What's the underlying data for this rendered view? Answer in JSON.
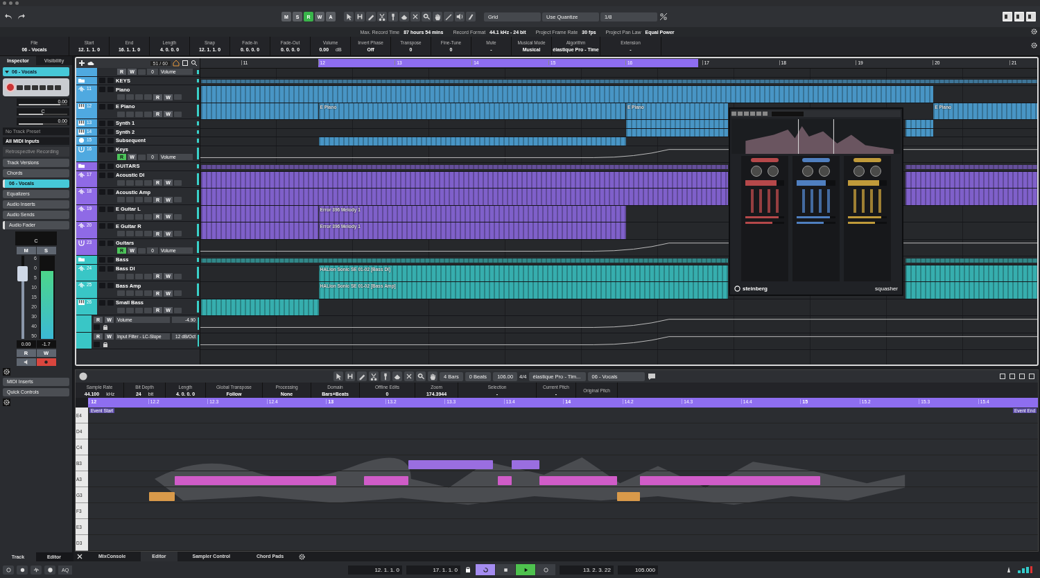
{
  "toolbar": {
    "mode_buttons": [
      {
        "label": "M",
        "on": false
      },
      {
        "label": "S",
        "on": false
      },
      {
        "label": "R",
        "on": true
      },
      {
        "label": "W",
        "on": false
      },
      {
        "label": "A",
        "on": false
      }
    ],
    "snap_type": "Grid",
    "quantize_mode": "Use Quantize",
    "quantize_value": "1/8"
  },
  "status": [
    {
      "label": "Max. Record Time",
      "value": "87 hours 54 mins"
    },
    {
      "label": "Record Format",
      "value": "44.1 kHz - 24 bit"
    },
    {
      "label": "Project Frame Rate",
      "value": "30 fps"
    },
    {
      "label": "Project Pan Law",
      "value": "Equal Power"
    }
  ],
  "infoline": [
    {
      "label": "File",
      "value": "06 - Vocals"
    },
    {
      "label": "Start",
      "value": "12. 1. 1. 0"
    },
    {
      "label": "End",
      "value": "16. 1. 1. 0"
    },
    {
      "label": "Length",
      "value": "4. 0. 0. 0"
    },
    {
      "label": "Snap",
      "value": "12. 1. 1. 0"
    },
    {
      "label": "Fade-In",
      "value": "0. 0. 0. 0"
    },
    {
      "label": "Fade-Out",
      "value": "0. 0. 0. 0"
    },
    {
      "label": "Volume",
      "value": "0.00",
      "unit": "dB"
    },
    {
      "label": "Invert Phase",
      "value": "Off"
    },
    {
      "label": "Transpose",
      "value": "0"
    },
    {
      "label": "Fine-Tune",
      "value": "0"
    },
    {
      "label": "Mute",
      "value": "-"
    },
    {
      "label": "Musical Mode",
      "value": "Musical"
    },
    {
      "label": "Algorithm",
      "value": "élastique Pro - Time"
    },
    {
      "label": "Extension",
      "value": "-"
    }
  ],
  "inspector": {
    "tabs": [
      {
        "label": "Inspector",
        "selected": true
      },
      {
        "label": "Visibility",
        "selected": false
      }
    ],
    "track_name": "06 - Vocals",
    "sliders": [
      {
        "kind": "volume",
        "value": "0.00",
        "level": 0.86
      },
      {
        "kind": "pan",
        "value": "C",
        "level": 0.5
      },
      {
        "kind": "delay",
        "value": "0.00",
        "level": 0.5
      }
    ],
    "preset": "No Track Preset",
    "input": "All MIDI Inputs",
    "retro": "Retrospective Recording",
    "sections": [
      {
        "label": "Track Versions",
        "kind": "section",
        "expanded": false
      },
      {
        "label": "Chords",
        "kind": "section",
        "expanded": false
      },
      {
        "label": "06 - Vocals",
        "kind": "track",
        "expanded": true
      },
      {
        "label": "Equalizers",
        "kind": "section",
        "expanded": false
      },
      {
        "label": "Audio Inserts",
        "kind": "section",
        "expanded": false
      },
      {
        "label": "Audio Sends",
        "kind": "section",
        "expanded": false
      },
      {
        "label": "Audio Fader",
        "kind": "section",
        "expanded": true
      }
    ],
    "fader": {
      "pan": "C",
      "top_buttons": [
        "M",
        "S"
      ],
      "scale": [
        "6",
        "0",
        "5",
        "10",
        "15",
        "20",
        "30",
        "40",
        "50"
      ],
      "level": 0.78,
      "meter": {
        "level": 0.82
      },
      "value": "0.00",
      "peak": "-1.7",
      "bottom_buttons": [
        "R",
        "W"
      ],
      "record": true
    },
    "more_sections": [
      {
        "label": "MIDI Inserts",
        "expanded": false
      },
      {
        "label": "Quick Controls",
        "expanded": false
      }
    ],
    "bottom_tabs": [
      {
        "label": "Track",
        "selected": false
      },
      {
        "label": "Editor",
        "selected": true
      }
    ]
  },
  "project": {
    "counter": "51 / 60",
    "bars": [
      "11",
      "12",
      "13",
      "14",
      "15",
      "16",
      "17",
      "18",
      "19",
      "20",
      "21"
    ],
    "tracks": [
      {
        "kind": "controls",
        "color": "#4fa9e0",
        "read": false,
        "value": "0",
        "field": "Volume",
        "buttons": [
          "R",
          "W"
        ]
      },
      {
        "kind": "folder",
        "name": "KEYS",
        "color": "#4fa9e0"
      },
      {
        "kind": "audio",
        "number": "11",
        "name": "Piano",
        "color": "#4fa9e0",
        "expanded": true,
        "buttons": [
          "R",
          "W"
        ]
      },
      {
        "kind": "instrument",
        "number": "12",
        "name": "E Piano",
        "color": "#4fa9e0",
        "expanded": true,
        "buttons": [
          "R",
          "W"
        ],
        "clips": [
          {
            "label": "E Piano"
          },
          {
            "label": "E Piano"
          },
          {
            "label": "E Piano"
          }
        ]
      },
      {
        "kind": "instrument",
        "number": "13",
        "name": "Synth 1",
        "color": "#4fa9e0",
        "expanded": false
      },
      {
        "kind": "instrument",
        "number": "14",
        "name": "Synth 2",
        "color": "#4fa9e0",
        "expanded": false
      },
      {
        "kind": "sampler",
        "number": "15",
        "name": "Subsequent",
        "color": "#4fa9e0",
        "expanded": false
      },
      {
        "kind": "group",
        "number": "16",
        "name": "Keys",
        "color": "#4fa9e0",
        "expanded": true,
        "read": true,
        "value": "0",
        "field": "Volume",
        "buttons": [
          "R",
          "W"
        ]
      },
      {
        "kind": "folder",
        "name": "GUITARS",
        "color": "#8f6ae6"
      },
      {
        "kind": "audio",
        "number": "17",
        "name": "Acoustic DI",
        "color": "#8f6ae6",
        "expanded": true,
        "buttons": [
          "R",
          "W"
        ]
      },
      {
        "kind": "audio",
        "number": "18",
        "name": "Acoustic Amp",
        "color": "#8f6ae6",
        "expanded": true,
        "buttons": [
          "R",
          "W"
        ]
      },
      {
        "kind": "audio",
        "number": "19",
        "name": "E Guitar L",
        "color": "#8f6ae6",
        "expanded": true,
        "buttons": [
          "R",
          "W"
        ],
        "clips": [
          {
            "label": "Error 396 Melody 1"
          }
        ]
      },
      {
        "kind": "audio",
        "number": "20",
        "name": "E Guitar R",
        "color": "#8f6ae6",
        "expanded": true,
        "buttons": [
          "R",
          "W"
        ],
        "clips": [
          {
            "label": "Error 396 Melody 1"
          }
        ]
      },
      {
        "kind": "group",
        "number": "23",
        "name": "Guitars",
        "color": "#8f6ae6",
        "expanded": true,
        "read": true,
        "value": "0",
        "field": "Volume",
        "buttons": [
          "R",
          "W"
        ]
      },
      {
        "kind": "folder",
        "name": "Bass",
        "color": "#39c6c6"
      },
      {
        "kind": "audio",
        "number": "24",
        "name": "Bass DI",
        "color": "#39c6c6",
        "expanded": true,
        "buttons": [
          "R",
          "W"
        ],
        "clips": [
          {
            "label": "HALion Sonic SE 01-02 [Bass DI]"
          }
        ]
      },
      {
        "kind": "audio",
        "number": "25",
        "name": "Bass Amp",
        "color": "#39c6c6",
        "expanded": true,
        "buttons": [
          "R",
          "W"
        ],
        "clips": [
          {
            "label": "HALion Sonic SE 01-02 [Bass Amp]"
          }
        ]
      },
      {
        "kind": "instrument",
        "number": "26",
        "name": "Small Bass",
        "color": "#39c6c6",
        "expanded": true,
        "buttons": [
          "R",
          "W"
        ]
      },
      {
        "kind": "automation",
        "color": "#39c6c6",
        "name": "Volume",
        "value": "-4.90",
        "buttons": [
          "R",
          "W"
        ]
      },
      {
        "kind": "automation",
        "color": "#39c6c6",
        "name": "Input Filter - LC-Slope",
        "value": "12 dB/Oct",
        "buttons": [
          "R",
          "W"
        ]
      }
    ]
  },
  "plugin": {
    "brand": "steinberg",
    "name": "squasher",
    "bands": [
      {
        "color": "#b5484a",
        "sliders": [
          {
            "level": 0.8
          },
          {
            "level": 0.85
          },
          {
            "level": 0.7
          }
        ]
      },
      {
        "color": "#4f7fc0",
        "sliders": [
          {
            "level": 0.75
          },
          {
            "level": 0.85
          },
          {
            "level": 0.7
          }
        ]
      },
      {
        "color": "#c09a3a",
        "sliders": [
          {
            "level": 0.8
          },
          {
            "level": 0.85
          },
          {
            "level": 0.7
          }
        ]
      }
    ]
  },
  "editor": {
    "toolbar": {
      "grid": "4 Bars",
      "offset": "0 Beats",
      "tempo": "106.00",
      "signature": "4/4",
      "algorithm": "élastique Pro - Tim...",
      "track": "06 - Vocals"
    },
    "infoline": [
      {
        "label": "Sample Rate",
        "value": "44.100",
        "unit": "kHz"
      },
      {
        "label": "Bit Depth",
        "value": "24",
        "unit": "bit"
      },
      {
        "label": "Length",
        "value": "4. 0. 0. 0"
      },
      {
        "label": "Global Transpose",
        "value": "Follow"
      },
      {
        "label": "Processing",
        "value": "None"
      },
      {
        "label": "Domain",
        "value": "Bars+Beats"
      },
      {
        "label": "Offline Edits",
        "value": "0"
      },
      {
        "label": "Zoom",
        "value": "174.3944"
      },
      {
        "label": "Selection",
        "value": "-"
      },
      {
        "label": "Current Pitch",
        "value": "-"
      },
      {
        "label": "Original Pitch"
      }
    ],
    "ruler": [
      "12",
      "12.2",
      "12.3",
      "12.4",
      "13",
      "13.2",
      "13.3",
      "13.4",
      "14",
      "14.2",
      "14.3",
      "14.4",
      "15",
      "15.2",
      "15.3",
      "15.4"
    ],
    "event_start": "Event Start",
    "event_end": "Event End",
    "keys": [
      {
        "label": "E4"
      },
      {
        "label": "D4"
      },
      {
        "label": "C4"
      },
      {
        "label": "B3",
        "notes": [
          {
            "color": "#9a6ee0"
          },
          {
            "color": "#9a6ee0"
          }
        ]
      },
      {
        "label": "A3",
        "notes": [
          {
            "color": "#d05cc8"
          },
          {
            "color": "#d05cc8"
          },
          {
            "color": "#d05cc8"
          },
          {
            "color": "#d05cc8"
          },
          {
            "color": "#d05cc8"
          }
        ]
      },
      {
        "label": "G3",
        "notes": [
          {
            "color": "#d99a4a"
          },
          {
            "color": "#d99a4a"
          }
        ]
      },
      {
        "label": "F3"
      },
      {
        "label": "E3"
      },
      {
        "label": "D3"
      }
    ]
  },
  "lower_tabs": [
    {
      "label": "MixConsole",
      "selected": false
    },
    {
      "label": "Editor",
      "selected": true
    },
    {
      "label": "Sampler Control",
      "selected": false
    },
    {
      "label": "Chord Pads",
      "selected": false
    }
  ],
  "transport": {
    "aq": "AQ",
    "left_locator": "12. 1. 1. 0",
    "right_locator": "17. 1. 1. 0",
    "cycle": true,
    "playing": true,
    "position": "13. 2. 3. 22",
    "tempo": "105.000"
  }
}
